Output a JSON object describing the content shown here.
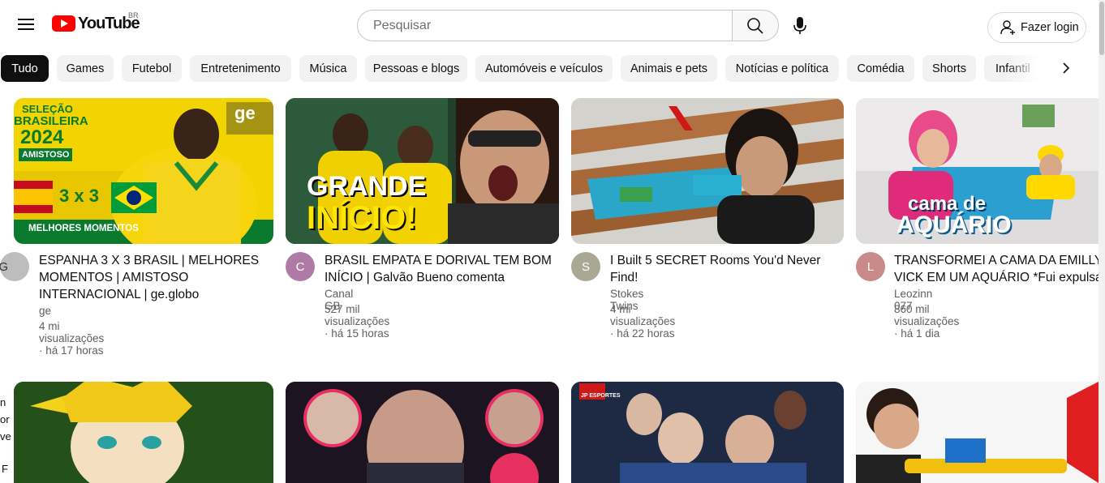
{
  "header": {
    "logo_text": "YouTube",
    "country": "BR",
    "search_placeholder": "Pesquisar",
    "login_label": "Fazer login"
  },
  "chips": [
    "Tudo",
    "Games",
    "Futebol",
    "Entretenimento",
    "Música",
    "Pessoas e blogs",
    "Automóveis e veículos",
    "Animais e pets",
    "Notícias e política",
    "Comédia",
    "Shorts",
    "Infantil"
  ],
  "videos": [
    {
      "title": "ESPANHA 3 X 3 BRASIL | MELHORES MOMENTOS | AMISTOSO INTERNACIONAL | ge.globo",
      "channel": "ge",
      "stats": "4 mi visualizações · há 17 horas",
      "avatar_letter": "G",
      "thumb_text": {
        "line1": "SELEÇÃO",
        "line2": "BRASILEIRA",
        "line3": "2024",
        "tag": "AMISTOSO",
        "score": "3 x 3",
        "bottom": "MELHORES MOMENTOS",
        "brand": "ge"
      }
    },
    {
      "title": "BRASIL EMPATA E DORIVAL TEM BOM INÍCIO | Galvão Bueno comenta",
      "channel": "Canal GB",
      "stats": "527 mil visualizações · há 15 horas",
      "avatar_letter": "C",
      "thumb_text": {
        "line1": "GRANDE",
        "line2": "INÍCIO!"
      }
    },
    {
      "title": "I Built 5 SECRET Rooms You'd Never Find!",
      "channel": "Stokes Twins",
      "stats": "4 mi visualizações · há 22 horas",
      "avatar_letter": "S",
      "thumb_text": {}
    },
    {
      "title": "TRANSFORMEI A CAMA DA EMILLY VICK EM UM AQUÁRIO *Fui expulsa",
      "channel": "Leozinn 077",
      "stats": "860 mil visualizações · há 1 dia",
      "avatar_letter": "L",
      "thumb_text": {
        "line1": "cama de",
        "line2": "AQUÁRIO"
      }
    }
  ],
  "second_row": [
    {
      "thumb_text": ""
    },
    {
      "thumb_text": ""
    },
    {
      "thumb_text": "JP ESPORTES"
    },
    {
      "thumb_text": ""
    }
  ],
  "side_fragments": [
    "n",
    "or",
    "ve",
    "F"
  ],
  "colors": {
    "brand_red": "#ff0000",
    "chip_bg": "#f2f2f2",
    "chip_active": "#0f0f0f",
    "secondary_text": "#606060"
  }
}
